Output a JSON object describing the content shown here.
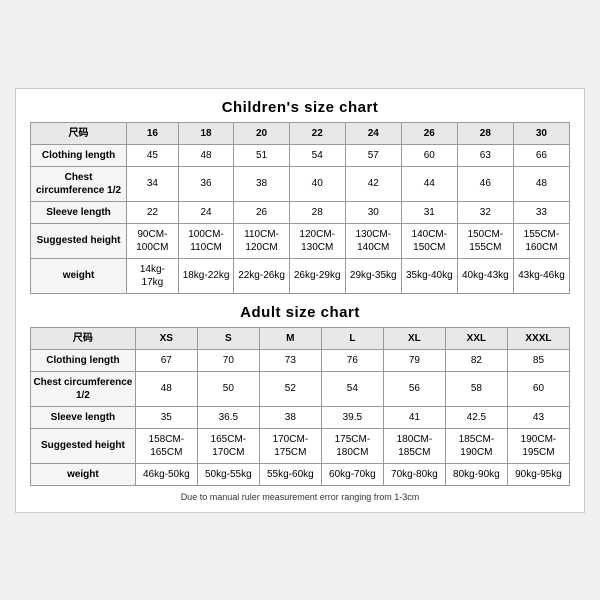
{
  "children_chart": {
    "title": "Children's size chart",
    "columns": [
      "尺码",
      "16",
      "18",
      "20",
      "22",
      "24",
      "26",
      "28",
      "30"
    ],
    "rows": [
      {
        "label": "Clothing length",
        "values": [
          "45",
          "48",
          "51",
          "54",
          "57",
          "60",
          "63",
          "66"
        ]
      },
      {
        "label": "Chest circumference 1/2",
        "values": [
          "34",
          "36",
          "38",
          "40",
          "42",
          "44",
          "46",
          "48"
        ]
      },
      {
        "label": "Sleeve length",
        "values": [
          "22",
          "24",
          "26",
          "28",
          "30",
          "31",
          "32",
          "33"
        ]
      },
      {
        "label": "Suggested height",
        "values": [
          "90CM-100CM",
          "100CM-110CM",
          "110CM-120CM",
          "120CM-130CM",
          "130CM-140CM",
          "140CM-150CM",
          "150CM-155CM",
          "155CM-160CM"
        ]
      },
      {
        "label": "weight",
        "values": [
          "14kg-17kg",
          "18kg-22kg",
          "22kg-26kg",
          "26kg-29kg",
          "29kg-35kg",
          "35kg-40kg",
          "40kg-43kg",
          "43kg-46kg"
        ]
      }
    ]
  },
  "adult_chart": {
    "title": "Adult size chart",
    "columns": [
      "尺码",
      "XS",
      "S",
      "M",
      "L",
      "XL",
      "XXL",
      "XXXL"
    ],
    "rows": [
      {
        "label": "Clothing length",
        "values": [
          "67",
          "70",
          "73",
          "76",
          "79",
          "82",
          "85"
        ]
      },
      {
        "label": "Chest circumference 1/2",
        "values": [
          "48",
          "50",
          "52",
          "54",
          "56",
          "58",
          "60"
        ]
      },
      {
        "label": "Sleeve length",
        "values": [
          "35",
          "36.5",
          "38",
          "39.5",
          "41",
          "42.5",
          "43"
        ]
      },
      {
        "label": "Suggested height",
        "values": [
          "158CM-165CM",
          "165CM-170CM",
          "170CM-175CM",
          "175CM-180CM",
          "180CM-185CM",
          "185CM-190CM",
          "190CM-195CM"
        ]
      },
      {
        "label": "weight",
        "values": [
          "46kg-50kg",
          "50kg-55kg",
          "55kg-60kg",
          "60kg-70kg",
          "70kg-80kg",
          "80kg-90kg",
          "90kg-95kg"
        ]
      }
    ]
  },
  "note": "Due to manual ruler measurement error ranging from 1-3cm"
}
